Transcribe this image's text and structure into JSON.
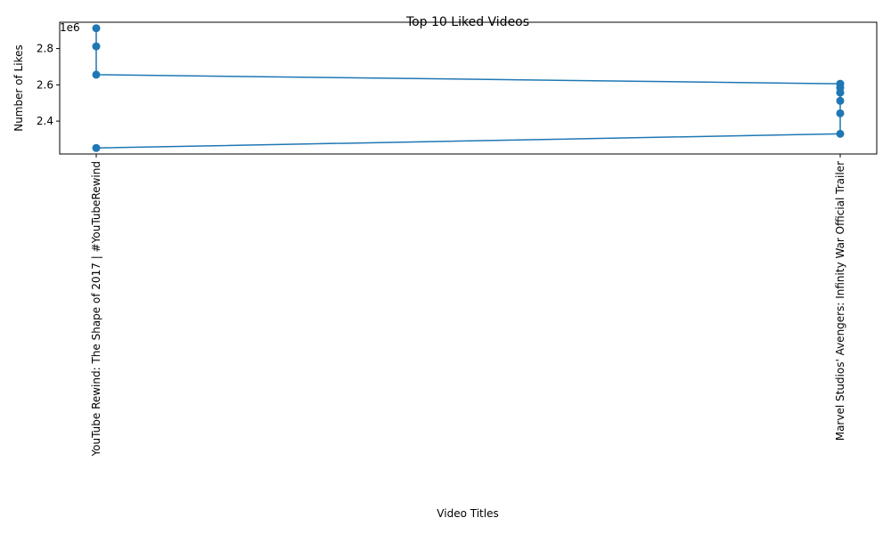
{
  "chart_data": {
    "type": "line",
    "title": "Top 10 Liked Videos",
    "xlabel": "Video Titles",
    "ylabel": "Number of Likes",
    "y_offset_label": "1e6",
    "categories": [
      "YouTube Rewind: The Shape of 2017 | #YouTubeRewind",
      "Marvel Studios' Avengers: Infinity War Official Trailer"
    ],
    "points": [
      {
        "x": "YouTube Rewind: The Shape of 2017 | #YouTubeRewind",
        "y": 2912000
      },
      {
        "x": "YouTube Rewind: The Shape of 2017 | #YouTubeRewind",
        "y": 2812000
      },
      {
        "x": "YouTube Rewind: The Shape of 2017 | #YouTubeRewind",
        "y": 2656000
      },
      {
        "x": "Marvel Studios' Avengers: Infinity War Official Trailer",
        "y": 2606000
      },
      {
        "x": "Marvel Studios' Avengers: Infinity War Official Trailer",
        "y": 2584000
      },
      {
        "x": "Marvel Studios' Avengers: Infinity War Official Trailer",
        "y": 2557000
      },
      {
        "x": "Marvel Studios' Avengers: Infinity War Official Trailer",
        "y": 2512000
      },
      {
        "x": "Marvel Studios' Avengers: Infinity War Official Trailer",
        "y": 2443000
      },
      {
        "x": "Marvel Studios' Avengers: Infinity War Official Trailer",
        "y": 2330000
      },
      {
        "x": "YouTube Rewind: The Shape of 2017 | #YouTubeRewind",
        "y": 2252000
      }
    ],
    "yticks": [
      2.4,
      2.6,
      2.8
    ],
    "ylim": [
      2219000,
      2945000
    ],
    "grid": false,
    "color": "#1f77b4"
  }
}
